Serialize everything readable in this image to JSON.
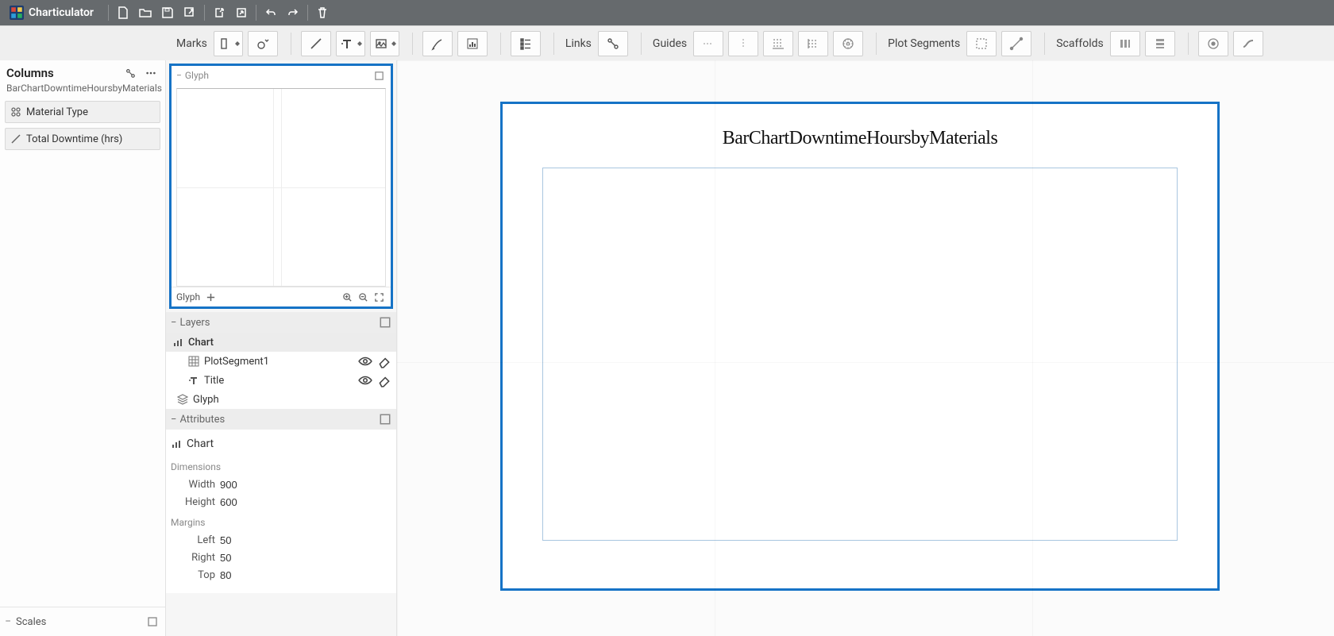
{
  "app": {
    "name": "Charticulator"
  },
  "columns": {
    "title": "Columns",
    "dataset": "BarChartDowntimeHoursbyMaterials",
    "fields": [
      {
        "label": "Material Type",
        "kind": "categorical"
      },
      {
        "label": "Total Downtime (hrs)",
        "kind": "measure"
      }
    ]
  },
  "scales": {
    "title": "Scales"
  },
  "toolbar": {
    "marks": "Marks",
    "links": "Links",
    "guides": "Guides",
    "plot_segments": "Plot Segments",
    "scaffolds": "Scaffolds"
  },
  "glyph_panel": {
    "title": "Glyph",
    "footer_label": "Glyph"
  },
  "layers": {
    "title": "Layers",
    "items": [
      {
        "label": "Chart",
        "kind": "chart"
      },
      {
        "label": "PlotSegment1",
        "child": true,
        "eye": true
      },
      {
        "label": "Title",
        "child": true,
        "eye": true
      },
      {
        "label": "Glyph",
        "kind": "glyph"
      }
    ]
  },
  "attributes": {
    "title": "Attributes",
    "object": "Chart",
    "dimensions_label": "Dimensions",
    "margins_label": "Margins",
    "dims": {
      "width_label": "Width",
      "width_value": "900",
      "height_label": "Height",
      "height_value": "600"
    },
    "margins": {
      "left_label": "Left",
      "left_value": "50",
      "right_label": "Right",
      "right_value": "50",
      "top_label": "Top",
      "top_value": "80"
    }
  },
  "chart": {
    "title": "BarChartDowntimeHoursbyMaterials"
  }
}
